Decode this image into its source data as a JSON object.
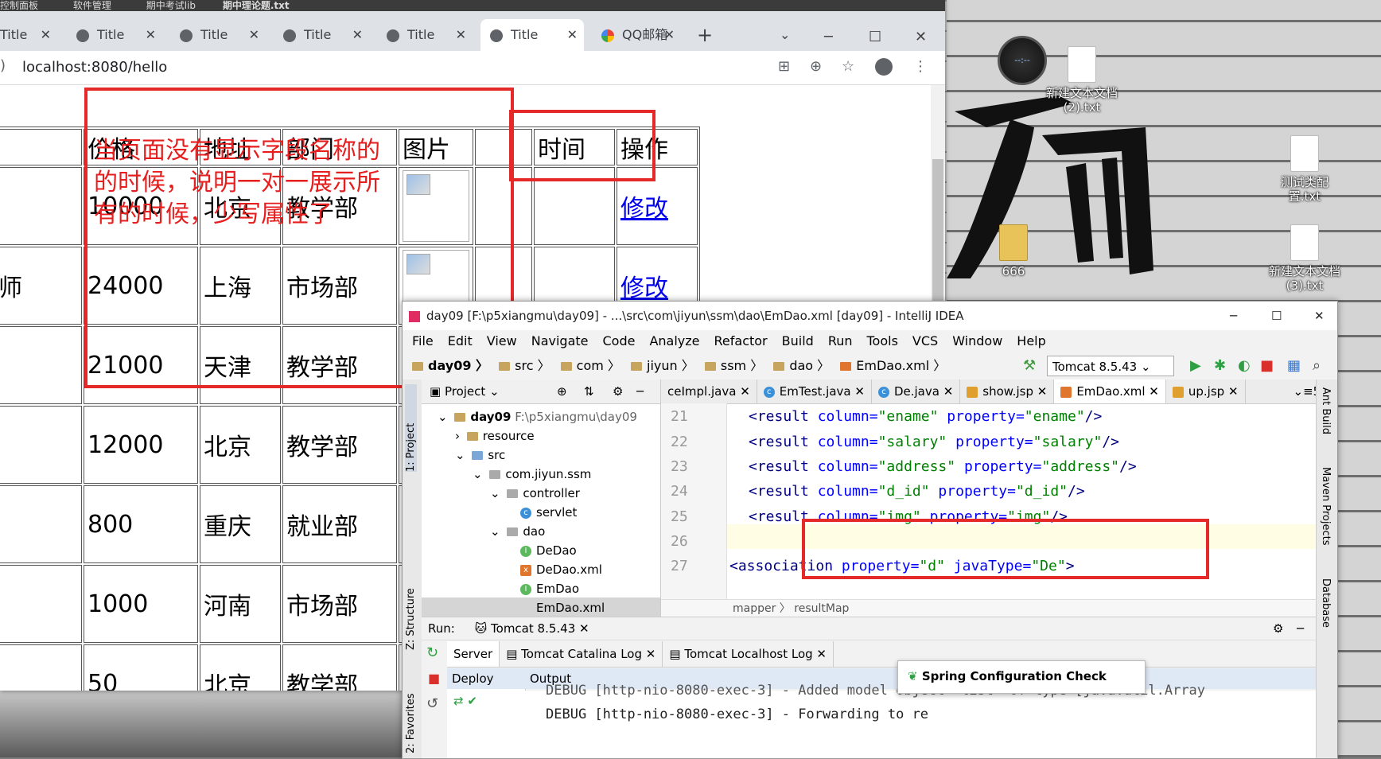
{
  "taskbar_items": [
    "控制面板",
    "软件管理",
    "期中考试lib"
  ],
  "browser": {
    "partial_title": "期中理论题.txt",
    "tabs": [
      {
        "label": "Title"
      },
      {
        "label": "Title"
      },
      {
        "label": "Title"
      },
      {
        "label": "Title"
      },
      {
        "label": "Title"
      },
      {
        "label": "Title",
        "active": true
      },
      {
        "label": "QQ邮箱"
      }
    ],
    "new_tab": "+",
    "url": "localhost:8080/hello",
    "window_controls": {
      "minimize": "─",
      "maximize": "☐",
      "close": "✕"
    }
  },
  "table": {
    "headers": [
      "价格",
      "地址",
      "部门",
      "图片",
      "",
      "时间",
      "操作"
    ],
    "rows": [
      {
        "lead": "",
        "price": "10000",
        "address": "北京",
        "dept": "教学部",
        "has_pic": true,
        "action": "修改"
      },
      {
        "lead": "师",
        "price": "24000",
        "address": "上海",
        "dept": "市场部",
        "has_pic": true,
        "action": "修改"
      },
      {
        "lead": "",
        "price": "21000",
        "address": "天津",
        "dept": "教学部",
        "has_pic": false,
        "action": ""
      },
      {
        "lead": "",
        "price": "12000",
        "address": "北京",
        "dept": "教学部",
        "has_pic": false,
        "action": ""
      },
      {
        "lead": "",
        "price": "800",
        "address": "重庆",
        "dept": "就业部",
        "has_pic": false,
        "action": ""
      },
      {
        "lead": "",
        "price": "1000",
        "address": "河南",
        "dept": "市场部",
        "has_pic": false,
        "action": ""
      },
      {
        "lead": "",
        "price": "50",
        "address": "北京",
        "dept": "教学部",
        "has_pic": false,
        "action": ""
      }
    ]
  },
  "annotation": "当页面没有显示字段名称的的时候，说明一对一展示所有的时候，少写属性了",
  "desktop": {
    "gadget_text": "--:--",
    "icons": [
      "新建文本文档\n(2).txt",
      "测试类配置.txt",
      "666",
      "新建文本文档\n(3).txt"
    ]
  },
  "ide": {
    "title": "day09 [F:\\p5xiangmu\\day09] - ...\\src\\com\\jiyun\\ssm\\dao\\EmDao.xml [day09] - IntelliJ IDEA",
    "menu": [
      "File",
      "Edit",
      "View",
      "Navigate",
      "Code",
      "Analyze",
      "Refactor",
      "Build",
      "Run",
      "Tools",
      "VCS",
      "Window",
      "Help"
    ],
    "breadcrumbs": [
      "day09",
      "src",
      "com",
      "jiyun",
      "ssm",
      "dao",
      "EmDao.xml"
    ],
    "run_config": "Tomcat 8.5.43",
    "project_panel_title": "Project",
    "tree": [
      {
        "label": "day09",
        "extra": "F:\\p5xiangmu\\day09",
        "depth": 0,
        "kind": "folder"
      },
      {
        "label": "resource",
        "depth": 1,
        "kind": "folder"
      },
      {
        "label": "src",
        "depth": 1,
        "kind": "folder"
      },
      {
        "label": "com.jiyun.ssm",
        "depth": 2,
        "kind": "folder"
      },
      {
        "label": "controller",
        "depth": 3,
        "kind": "folder"
      },
      {
        "label": "servlet",
        "depth": 4,
        "kind": "class"
      },
      {
        "label": "dao",
        "depth": 3,
        "kind": "folder"
      },
      {
        "label": "DeDao",
        "depth": 4,
        "kind": "interface"
      },
      {
        "label": "DeDao.xml",
        "depth": 4,
        "kind": "xml"
      },
      {
        "label": "EmDao",
        "depth": 4,
        "kind": "interface"
      },
      {
        "label": "EmDao.xml",
        "depth": 4,
        "kind": "xml"
      }
    ],
    "editor_tabs": [
      "ceImpl.java",
      "EmTest.java",
      "De.java",
      "show.jsp",
      "EmDao.xml",
      "up.jsp"
    ],
    "tab_overflow": "5",
    "code": [
      {
        "n": "21",
        "pre": "<result ",
        "a1": "column=",
        "v1": "\"ename\"",
        "a2": " property=",
        "v2": "\"ename\"",
        "end": "/>"
      },
      {
        "n": "22",
        "pre": "<result ",
        "a1": "column=",
        "v1": "\"salary\"",
        "a2": " property=",
        "v2": "\"salary\"",
        "end": "/>"
      },
      {
        "n": "23",
        "pre": "<result ",
        "a1": "column=",
        "v1": "\"address\"",
        "a2": " property=",
        "v2": "\"address\"",
        "end": "/>"
      },
      {
        "n": "24",
        "pre": "<result ",
        "a1": "column=",
        "v1": "\"d_id\"",
        "a2": " property=",
        "v2": "\"d_id\"",
        "end": "/>"
      },
      {
        "n": "25",
        "pre": "<result  ",
        "a1": "column=",
        "v1": "\"img\"",
        "a2": " property=",
        "v2": "\"img\"",
        "end": "/>"
      },
      {
        "n": "26",
        "pre": "",
        "a1": "",
        "v1": "",
        "a2": "",
        "v2": "",
        "end": ""
      },
      {
        "n": "27",
        "pre": "<association ",
        "a1": "property=",
        "v1": "\"d\"",
        "a2": " javaType=",
        "v2": "\"De\"",
        "end": ">"
      }
    ],
    "editor_breadcrumb": [
      "mapper",
      "resultMap"
    ],
    "run": {
      "label": "Run:",
      "config": "Tomcat 8.5.43",
      "tabs": [
        "Server",
        "Tomcat Catalina Log",
        "Tomcat Localhost Log"
      ],
      "deploy_label": "Deploy",
      "output_label": "Output",
      "console": [
        "DEBUG [http-nio-8080-exec-3] - Added model object 'list' of type [java.util.Array",
        "DEBUG [http-nio-8080-exec-3] - Forwarding to re"
      ]
    },
    "left_tool_tabs": [
      "1: Project",
      "Z: Structure",
      "2: Favorites"
    ],
    "right_tool_tabs": [
      "Ant Build",
      "Maven Projects",
      "Database"
    ],
    "popup": "Spring Configuration Check",
    "window_controls": {
      "minimize": "─",
      "maximize": "☐",
      "close": "✕"
    }
  }
}
